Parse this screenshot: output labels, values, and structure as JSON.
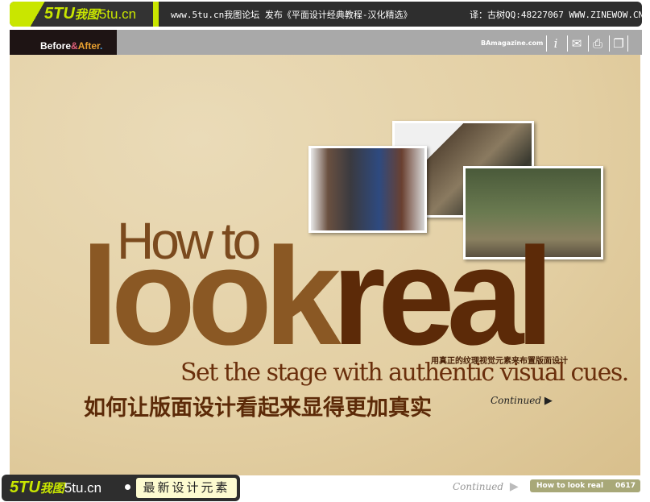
{
  "top_bar": {
    "logo_mark": "5TU",
    "logo_cn": "我图",
    "logo_domain": "5tu.cn",
    "message": "www.5tu.cn我图论坛 发布《平面设计经典教程-汉化精选》",
    "credit": "译：古树QQ:48227067 WWW.ZINEWOW.CN"
  },
  "nav_bar": {
    "brand_before": "Before",
    "brand_amp": "&",
    "brand_after": "After",
    "brand_dot": ".",
    "site": "BAmagazine.com",
    "icons": [
      "info-icon",
      "mail-icon",
      "print-icon",
      "window-icon"
    ]
  },
  "article": {
    "how_to": "How to",
    "look": "look",
    "real": "real",
    "subtitle_cn": "用真正的纹理视觉元素来布置版面设计",
    "tagline": "Set the stage with authentic visual cues.",
    "title_cn": "如何让版面设计看起来显得更加真实",
    "continued": "Continued"
  },
  "footer": {
    "logo_mark": "5TU",
    "logo_cn": "我图",
    "logo_domain": "5tu.cn",
    "slogan": "最新设计元素",
    "continued": "Continued",
    "page_title": "How to look real",
    "page_number": "0617"
  }
}
